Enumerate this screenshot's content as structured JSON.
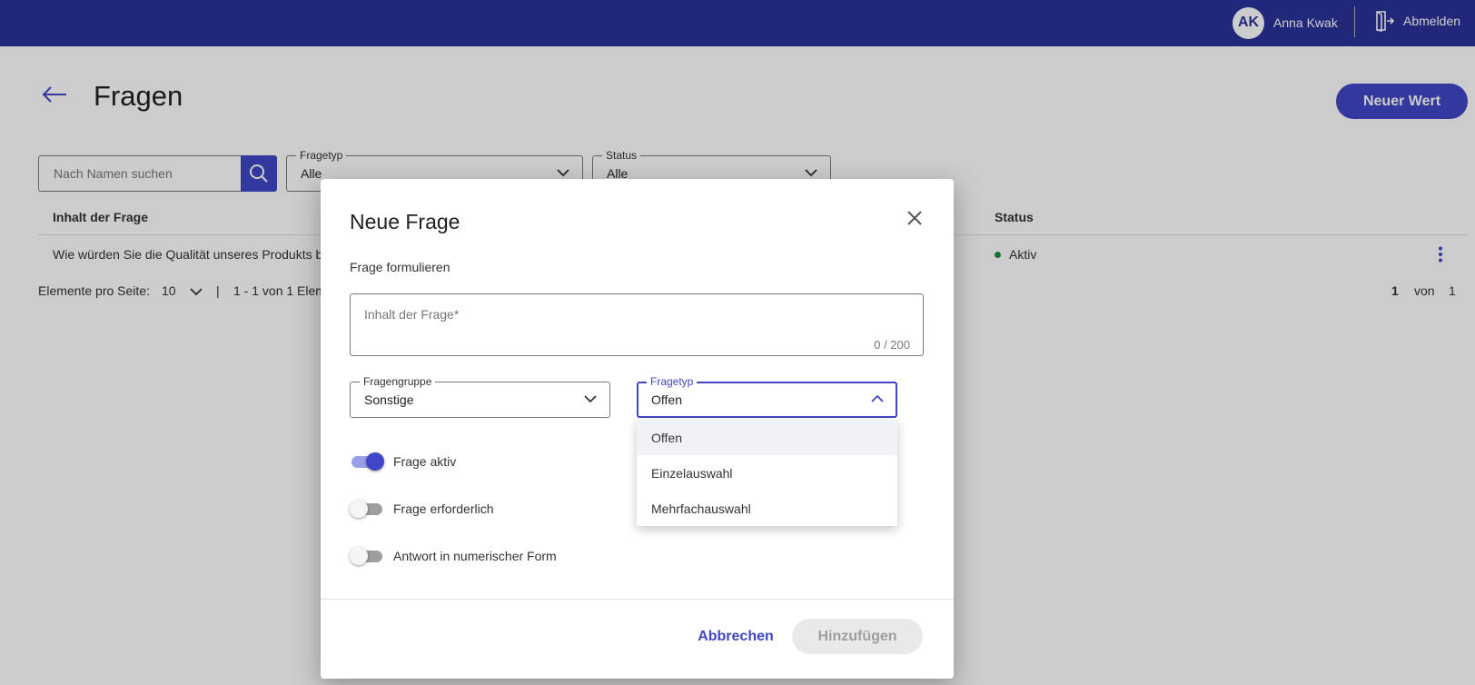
{
  "header": {
    "user_initials": "AK",
    "user_name": "Anna Kwak",
    "logout_label": "Abmelden"
  },
  "page": {
    "title": "Fragen",
    "new_button": "Neuer Wert"
  },
  "filters": {
    "search_placeholder": "Nach Namen suchen",
    "type_label": "Fragetyp",
    "type_value": "Alle",
    "status_label": "Status",
    "status_value": "Alle"
  },
  "table": {
    "columns": [
      "Inhalt der Frage",
      "Status"
    ],
    "rows": [
      {
        "content": "Wie würden Sie die Qualität unseres Produkts be",
        "status": "Aktiv"
      }
    ]
  },
  "pagination": {
    "per_page_label": "Elemente pro Seite:",
    "per_page_value": "10",
    "separator": "|",
    "range": "1 - 1 von 1 Elem",
    "current_page": "1",
    "of_label": "von",
    "total_pages": "1"
  },
  "dialog": {
    "title": "Neue Frage",
    "subtitle": "Frage formulieren",
    "content_placeholder": "Inhalt der Frage*",
    "counter": "0 / 200",
    "group_label": "Fragengruppe",
    "group_value": "Sonstige",
    "type_label": "Fragetyp",
    "type_value": "Offen",
    "type_options": [
      "Offen",
      "Einzelauswahl",
      "Mehrfachauswahl"
    ],
    "toggles": [
      {
        "label": "Frage aktiv",
        "on": true
      },
      {
        "label": "Frage erforderlich",
        "on": false
      },
      {
        "label": "Antwort in numerischer Form",
        "on": false
      }
    ],
    "cancel_label": "Abbrechen",
    "add_label": "Hinzufügen"
  },
  "colors": {
    "topbar": "#2b3398",
    "primary": "#3f47c6",
    "status_active": "#1e8e3e"
  }
}
